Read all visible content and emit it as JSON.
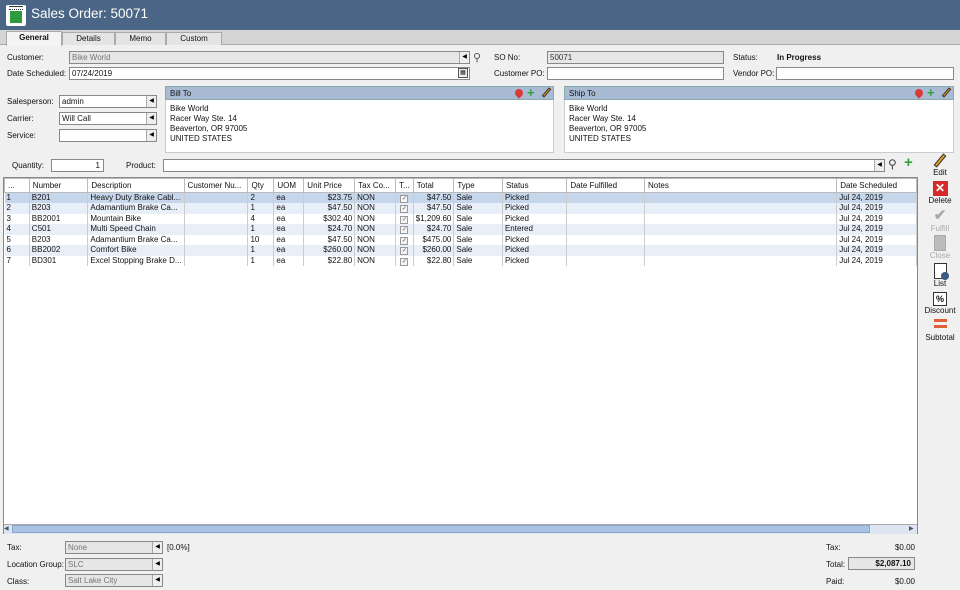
{
  "window": {
    "title": "Sales Order: 50071"
  },
  "tabs": [
    {
      "label": "General"
    },
    {
      "label": "Details"
    },
    {
      "label": "Memo"
    },
    {
      "label": "Custom"
    }
  ],
  "header": {
    "customer_label": "Customer:",
    "customer_value": "Bike World",
    "date_scheduled_label": "Date Scheduled:",
    "date_scheduled_value": "07/24/2019",
    "so_no_label": "SO No:",
    "so_no_value": "50071",
    "customer_po_label": "Customer PO:",
    "customer_po_value": "",
    "status_label": "Status:",
    "status_value": "In Progress",
    "vendor_po_label": "Vendor PO:",
    "vendor_po_value": ""
  },
  "left_fields": {
    "salesperson_label": "Salesperson:",
    "salesperson_value": "admin",
    "carrier_label": "Carrier:",
    "carrier_value": "Will Call",
    "service_label": "Service:",
    "service_value": ""
  },
  "bill_to": {
    "title": "Bill To",
    "lines": [
      "Bike World",
      "Racer Way Ste. 14",
      "Beaverton, OR  97005",
      "UNITED STATES"
    ]
  },
  "ship_to": {
    "title": "Ship To",
    "lines": [
      "Bike World",
      "Racer Way Ste. 14",
      "Beaverton, OR  97005",
      "UNITED STATES"
    ]
  },
  "entry": {
    "quantity_label": "Quantity:",
    "quantity_value": "1",
    "product_label": "Product:",
    "product_value": ""
  },
  "grid": {
    "columns": [
      "...",
      "Number",
      "Description",
      "Customer Nu...",
      "Qty",
      "UOM",
      "Unit Price",
      "Tax Co...",
      "T...",
      "Total",
      "Type",
      "Status",
      "Date Fulfilled",
      "Notes",
      "Date Scheduled"
    ],
    "rows": [
      {
        "n": "1",
        "number": "B201",
        "description": "Heavy Duty Brake Cabl...",
        "cust": "",
        "qty": "2",
        "uom": "ea",
        "unit_price": "$23.75",
        "tax_code": "NON",
        "total": "$47.50",
        "type": "Sale",
        "status": "Picked",
        "fulfilled": "",
        "notes": "",
        "scheduled": "Jul 24, 2019"
      },
      {
        "n": "2",
        "number": "B203",
        "description": "Adamantium Brake Ca...",
        "cust": "",
        "qty": "1",
        "uom": "ea",
        "unit_price": "$47.50",
        "tax_code": "NON",
        "total": "$47.50",
        "type": "Sale",
        "status": "Picked",
        "fulfilled": "",
        "notes": "",
        "scheduled": "Jul 24, 2019"
      },
      {
        "n": "3",
        "number": "BB2001",
        "description": "Mountain Bike",
        "cust": "",
        "qty": "4",
        "uom": "ea",
        "unit_price": "$302.40",
        "tax_code": "NON",
        "total": "$1,209.60",
        "type": "Sale",
        "status": "Picked",
        "fulfilled": "",
        "notes": "",
        "scheduled": "Jul 24, 2019"
      },
      {
        "n": "4",
        "number": "C501",
        "description": "Multi Speed Chain",
        "cust": "",
        "qty": "1",
        "uom": "ea",
        "unit_price": "$24.70",
        "tax_code": "NON",
        "total": "$24.70",
        "type": "Sale",
        "status": "Entered",
        "fulfilled": "",
        "notes": "",
        "scheduled": "Jul 24, 2019"
      },
      {
        "n": "5",
        "number": "B203",
        "description": "Adamantium Brake Ca...",
        "cust": "",
        "qty": "10",
        "uom": "ea",
        "unit_price": "$47.50",
        "tax_code": "NON",
        "total": "$475.00",
        "type": "Sale",
        "status": "Picked",
        "fulfilled": "",
        "notes": "",
        "scheduled": "Jul 24, 2019"
      },
      {
        "n": "6",
        "number": "BB2002",
        "description": "Comfort Bike",
        "cust": "",
        "qty": "1",
        "uom": "ea",
        "unit_price": "$260.00",
        "tax_code": "NON",
        "total": "$260.00",
        "type": "Sale",
        "status": "Picked",
        "fulfilled": "",
        "notes": "",
        "scheduled": "Jul 24, 2019"
      },
      {
        "n": "7",
        "number": "BD301",
        "description": "Excel Stopping Brake D...",
        "cust": "",
        "qty": "1",
        "uom": "ea",
        "unit_price": "$22.80",
        "tax_code": "NON",
        "total": "$22.80",
        "type": "Sale",
        "status": "Picked",
        "fulfilled": "",
        "notes": "",
        "scheduled": "Jul 24, 2019"
      }
    ]
  },
  "side_actions": [
    {
      "label": "Edit",
      "icon": "pencil-icon",
      "enabled": true
    },
    {
      "label": "Delete",
      "icon": "delete-x-icon",
      "enabled": true
    },
    {
      "label": "Fulfill",
      "icon": "checkmark-icon",
      "enabled": false
    },
    {
      "label": "Close",
      "icon": "close-doc-icon",
      "enabled": false
    },
    {
      "label": "List",
      "icon": "list-icon",
      "enabled": true
    },
    {
      "label": "Discount",
      "icon": "percent-icon",
      "enabled": true
    },
    {
      "label": "Subtotal",
      "icon": "subtotal-icon",
      "enabled": true
    }
  ],
  "footer": {
    "tax_label": "Tax:",
    "tax_value": "None",
    "tax_rate": "[0.0%]",
    "location_group_label": "Location Group:",
    "location_group_value": "SLC",
    "class_label": "Class:",
    "class_value": "Salt Lake City",
    "tax_total_label": "Tax:",
    "tax_total_value": "$0.00",
    "total_label": "Total:",
    "total_value": "$2,087.10",
    "paid_label": "Paid:",
    "paid_value": "$0.00"
  },
  "colors": {
    "titlebar": "#4a6585",
    "panel_header": "#a9bbd4",
    "selected_row": "#c6d7ec",
    "plus_green": "#2fa33a",
    "delete_red": "#d42a2a"
  }
}
